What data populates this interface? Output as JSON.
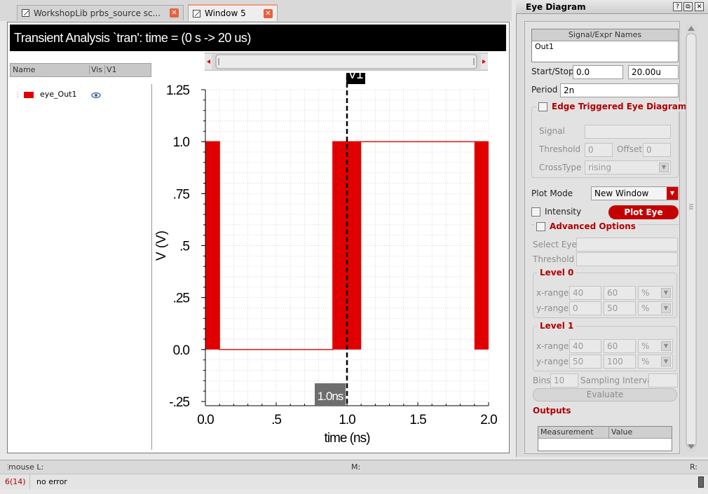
{
  "tabs": [
    {
      "label": "WorkshopLib prbs_source sc..."
    },
    {
      "label": "Window 5"
    }
  ],
  "plot_title": "Transient Analysis `tran': time = (0 s -> 20 us)",
  "legend": {
    "headers": [
      "Name",
      "Vis",
      "V1"
    ],
    "items": [
      {
        "name": "eye_Out1",
        "color": "#e00000"
      }
    ]
  },
  "marker": {
    "label": "V1",
    "readout": "1.0ns"
  },
  "chart_data": {
    "type": "line",
    "xlabel": "time (ns)",
    "ylabel": "V (V)",
    "xlim": [
      0.0,
      2.0
    ],
    "ylim": [
      -0.25,
      1.25
    ],
    "xticks": [
      "0.0",
      ".5",
      "1.0",
      "1.5",
      "2.0"
    ],
    "yticks": [
      "1.25",
      "1.0",
      ".75",
      ".5",
      ".25",
      "0.0",
      "-.25"
    ],
    "grid": true,
    "series": [
      {
        "name": "eye_Out1",
        "color": "#e00000",
        "x": [
          0.0,
          0.1,
          0.1,
          0.9,
          0.9,
          1.1,
          1.1,
          1.9,
          1.9,
          2.0
        ],
        "y": [
          1.0,
          1.0,
          0.0,
          0.0,
          1.0,
          1.0,
          1.0,
          1.0,
          1.0,
          1.0
        ]
      }
    ],
    "dense_regions": [
      {
        "x_from": 0.0,
        "x_to": 0.1
      },
      {
        "x_from": 0.9,
        "x_to": 1.1
      },
      {
        "x_from": 1.9,
        "x_to": 2.0
      }
    ],
    "marker_x": 1.0
  },
  "panel": {
    "title": "Eye Diagram",
    "signal_expr_header": "Signal/Expr Names",
    "signal_expr_value": "Out1",
    "start_stop_label": "Start/Stop",
    "start_value": "0.0",
    "stop_value": "20.00u",
    "period_label": "Period",
    "period_value": "2n",
    "edge_triggered_label": "Edge Triggered Eye Diagram",
    "signal_label": "Signal",
    "threshold_label": "Threshold",
    "threshold_value": "0",
    "offset_label": "Offset",
    "offset_value": "0",
    "crosstype_label": "CrossType",
    "crosstype_value": "rising",
    "plot_mode_label": "Plot Mode",
    "plot_mode_value": "New Window",
    "intensity_label": "Intensity",
    "plot_eye_button": "Plot Eye",
    "advanced_label": "Advanced Options",
    "select_eye_label": "Select Eye",
    "threshold2_label": "Threshold",
    "level0_label": "Level 0",
    "level0": {
      "xrange_label": "x-range",
      "x1": "40",
      "x2": "60",
      "xunit": "%",
      "yrange_label": "y-range",
      "y1": "0",
      "y2": "50",
      "yunit": "%"
    },
    "level1_label": "Level 1",
    "level1": {
      "xrange_label": "x-range",
      "x1": "40",
      "x2": "60",
      "xunit": "%",
      "yrange_label": "y-range",
      "y1": "50",
      "y2": "100",
      "yunit": "%"
    },
    "bins_label": "Bins",
    "bins_value": "10",
    "sampling_label": "Sampling Interval",
    "evaluate_button": "Evaluate",
    "outputs_label": "Outputs",
    "outputs_headers": [
      "Measurement",
      "Value"
    ]
  },
  "status": {
    "mouse_l": "mouse L:",
    "m": "M:",
    "r": "R:",
    "count": "6(14)",
    "message": "no error"
  }
}
